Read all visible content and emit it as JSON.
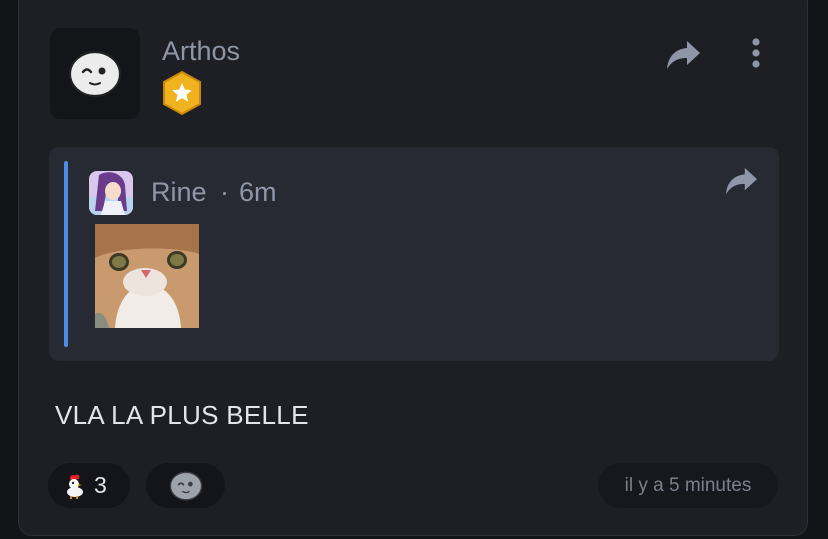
{
  "post": {
    "author": "Arthos",
    "author_avatar_icon": "smiley-face-icon",
    "badge_icon": "star-badge-icon",
    "badge_color": "#f0b21e"
  },
  "toolbar": {
    "forward_icon": "forward-arrow-icon",
    "more_icon": "more-vertical-icon"
  },
  "quoted": {
    "author": "Rine",
    "separator": "·",
    "time": "6m",
    "avatar_icon": "anime-avatar",
    "image": "cat-photo",
    "accent_color": "#4a8ee6"
  },
  "message": {
    "text": "VLA LA PLUS BELLE"
  },
  "reactions": [
    {
      "emoji": "chicken-emoji",
      "count": "3"
    },
    {
      "emoji": "add-reaction-icon"
    }
  ],
  "timestamp": "il y a 5 minutes"
}
